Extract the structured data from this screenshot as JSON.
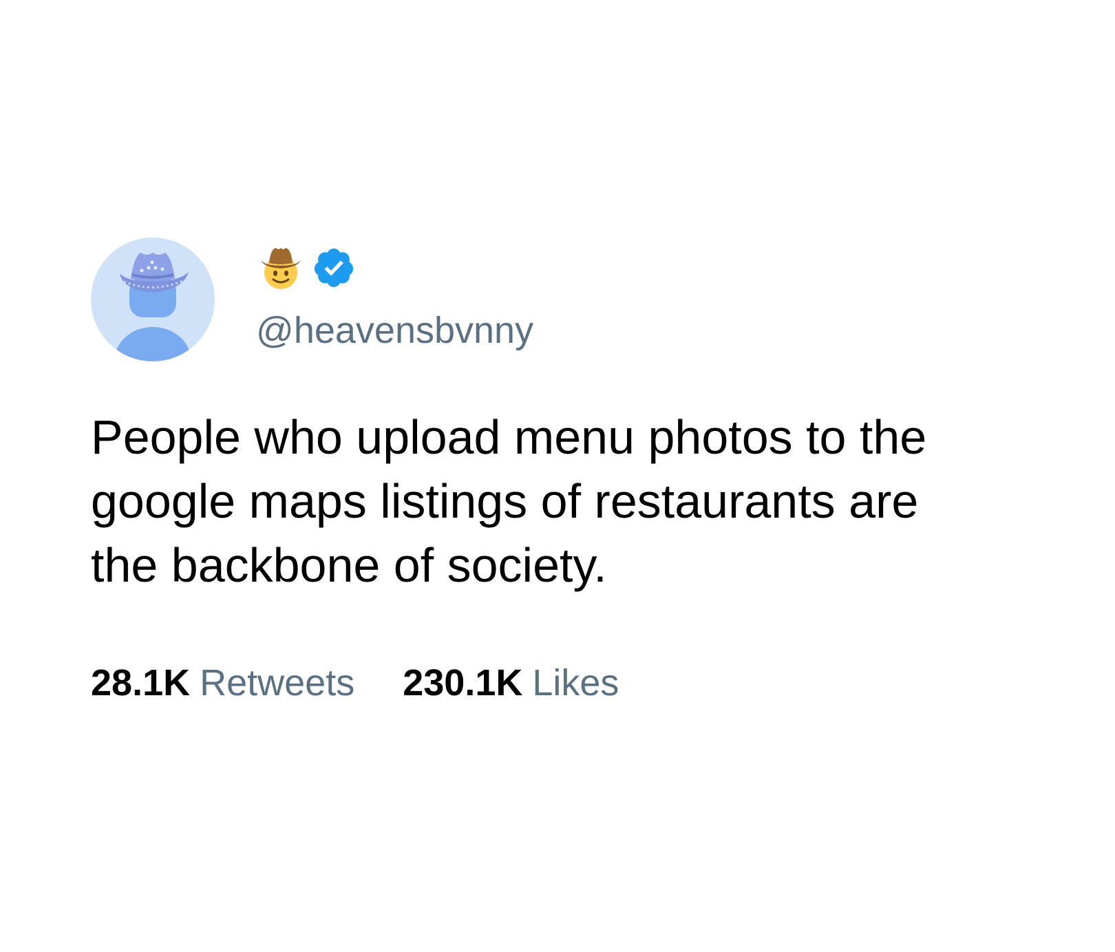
{
  "tweet": {
    "avatar_icon": "cowboy-hat-silhouette-avatar",
    "name_emoji_icon": "cowboy-hat-face-emoji",
    "verified_icon": "verified-badge-icon",
    "handle": "@heavensbvnny",
    "text": "People who upload menu photos to the\ngoogle maps listings of restaurants are\nthe backbone of society.",
    "stats": {
      "retweets_count": "28.1K",
      "retweets_label": "Retweets",
      "likes_count": "230.1K",
      "likes_label": "Likes"
    }
  },
  "colors": {
    "text": "#000000",
    "secondary_text": "#5b7083",
    "verified": "#1d9bf0",
    "avatar_background": "#cfe2f7",
    "avatar_figure": "#7aaaf0"
  }
}
